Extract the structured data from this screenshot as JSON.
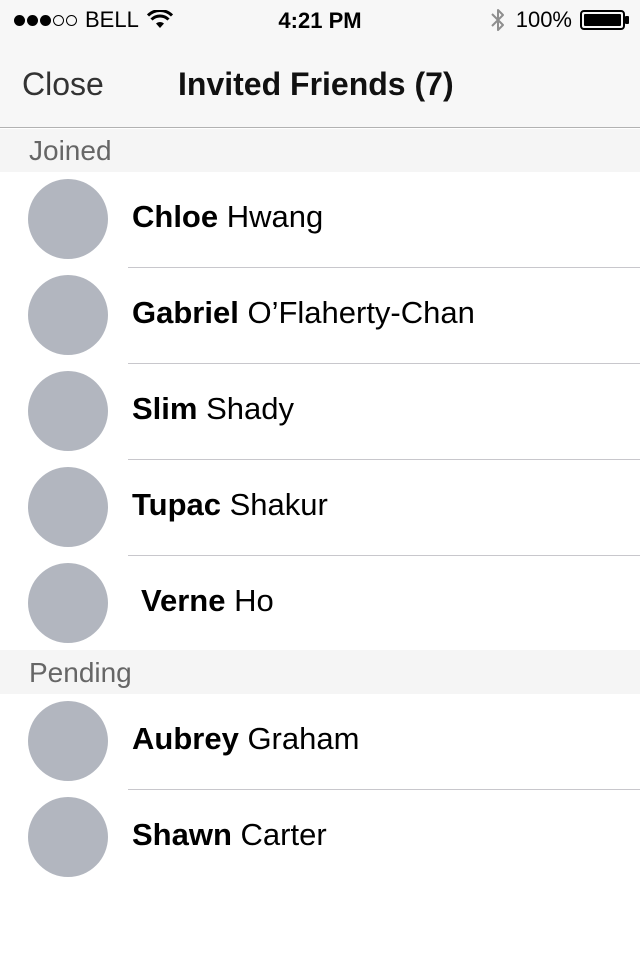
{
  "status_bar": {
    "carrier": "BELL",
    "time": "4:21 PM",
    "battery_level": "100%",
    "icons": [
      "signal-dots-icon",
      "wifi-icon",
      "bluetooth-icon",
      "battery-icon"
    ]
  },
  "nav": {
    "close_label": "Close",
    "title": "Invited Friends (7)"
  },
  "sections": {
    "joined": {
      "header": "Joined",
      "friends": [
        {
          "first": "Chloe",
          "last": "Hwang"
        },
        {
          "first": "Gabriel",
          "last": "O’Flaherty-Chan"
        },
        {
          "first": "Slim",
          "last": "Shady"
        },
        {
          "first": "Tupac",
          "last": "Shakur"
        },
        {
          "first": "Verne",
          "last": "Ho"
        }
      ]
    },
    "pending": {
      "header": "Pending",
      "friends": [
        {
          "first": "Aubrey",
          "last": "Graham"
        },
        {
          "first": "Shawn",
          "last": "Carter"
        }
      ]
    }
  },
  "colors": {
    "avatar_placeholder": "#b2b6bf",
    "section_background": "#f5f5f5",
    "separator": "#c8c7cc"
  }
}
